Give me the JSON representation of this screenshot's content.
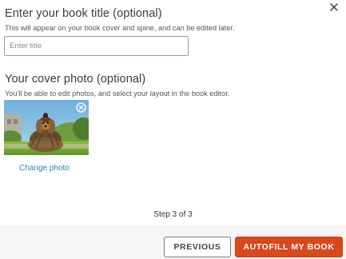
{
  "dialog": {
    "close_icon": "close-icon",
    "title_section": {
      "heading": "Enter your book title (optional)",
      "description": "This will appear on your book cover and spine, and can be edited later.",
      "input_value": "",
      "input_placeholder": "Enter title"
    },
    "cover_section": {
      "heading": "Your cover photo (optional)",
      "description": "You'll be able to edit photos, and select your layout in the book editor.",
      "photo_subject": "dog-photo",
      "remove_icon": "remove-photo-icon",
      "change_photo_label": "Change photo"
    },
    "step_label": "Step 3 of 3",
    "footer": {
      "previous_label": "PREVIOUS",
      "autofill_label": "AUTOFILL MY BOOK"
    }
  },
  "colors": {
    "primary_button": "#d9481c",
    "link": "#2f7fb5",
    "footer_background": "#f6f6f6"
  }
}
